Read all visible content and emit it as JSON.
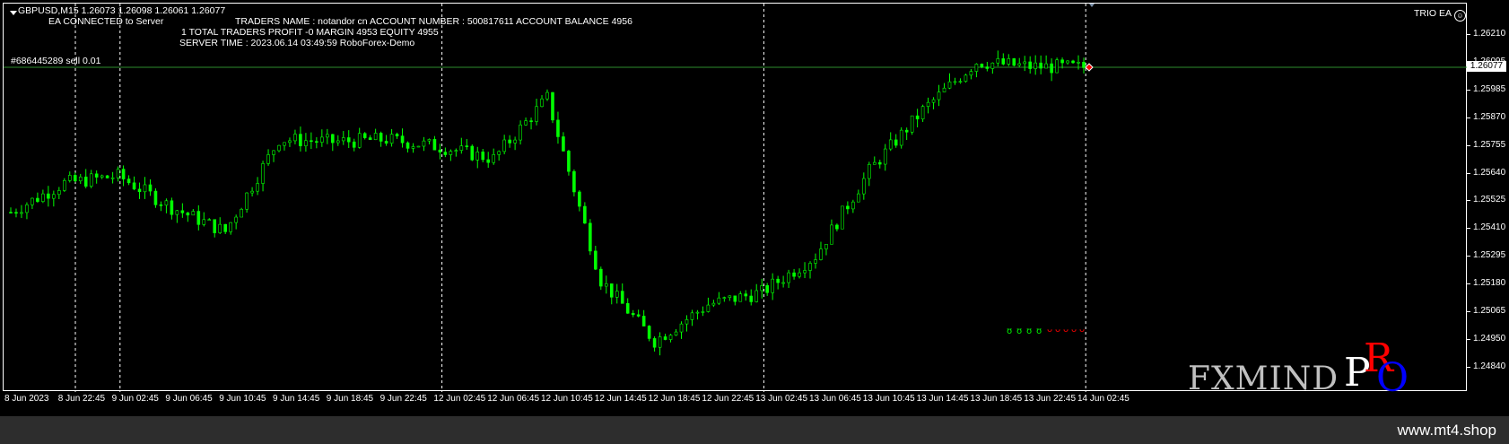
{
  "header": {
    "symbol_line": "GBPUSD,M15  1.26073 1.26098 1.26061 1.26077",
    "ea_status": "EA CONNECTED to Server",
    "traders_line": "TRADERS NAME : notandor cn  ACCOUNT NUMBER : 500817611 ACCOUNT BALANCE 4956",
    "totals_line": "1 TOTAL TRADERS  PROFIT -0 MARGIN 4953 EQUITY 4955",
    "server_line": "SERVER TIME : 2023.06.14 03:49:59  RoboForex-Demo",
    "expert_name": "TRIO EA",
    "expert_icon": "smiley-icon"
  },
  "order": {
    "label": "#686445289 sell 0.01"
  },
  "price_axis": {
    "ticks": [
      "1.26210",
      "1.26095",
      "1.25985",
      "1.25870",
      "1.25755",
      "1.25640",
      "1.25525",
      "1.25410",
      "1.25295",
      "1.25180",
      "1.25065",
      "1.24950",
      "1.24840"
    ],
    "current_price": "1.26077"
  },
  "time_axis": {
    "ticks": [
      "8 Jun 2023",
      "8 Jun 22:45",
      "9 Jun 02:45",
      "9 Jun 06:45",
      "9 Jun 10:45",
      "9 Jun 14:45",
      "9 Jun 18:45",
      "9 Jun 22:45",
      "12 Jun 02:45",
      "12 Jun 06:45",
      "12 Jun 10:45",
      "12 Jun 14:45",
      "12 Jun 18:45",
      "12 Jun 22:45",
      "13 Jun 02:45",
      "13 Jun 06:45",
      "13 Jun 10:45",
      "13 Jun 14:45",
      "13 Jun 18:45",
      "13 Jun 22:45",
      "14 Jun 02:45"
    ]
  },
  "chart_data": {
    "type": "candlestick",
    "symbol": "GBPUSD",
    "timeframe": "M15",
    "ylim": [
      1.2484,
      1.2625
    ],
    "last": 1.26077,
    "candle_color": "#00ff00",
    "path_key_points": [
      {
        "x": "8 Jun 2023",
        "y": 1.2548
      },
      {
        "x": "8 Jun 22:45",
        "y": 1.256
      },
      {
        "x": "9 Jun 02:45",
        "y": 1.2563
      },
      {
        "x": "9 Jun 06:45",
        "y": 1.255
      },
      {
        "x": "9 Jun 10:45",
        "y": 1.254
      },
      {
        "x": "9 Jun 14:45",
        "y": 1.2578
      },
      {
        "x": "9 Jun 18:45",
        "y": 1.2577
      },
      {
        "x": "9 Jun 22:45",
        "y": 1.2578
      },
      {
        "x": "12 Jun 02:45",
        "y": 1.2575
      },
      {
        "x": "12 Jun 06:45",
        "y": 1.257
      },
      {
        "x": "12 Jun 10:45",
        "y": 1.2595
      },
      {
        "x": "12 Jun 14:45",
        "y": 1.252
      },
      {
        "x": "12 Jun 18:45",
        "y": 1.2495
      },
      {
        "x": "12 Jun 22:45",
        "y": 1.251
      },
      {
        "x": "13 Jun 02:45",
        "y": 1.2515
      },
      {
        "x": "13 Jun 06:45",
        "y": 1.253
      },
      {
        "x": "13 Jun 10:45",
        "y": 1.2565
      },
      {
        "x": "13 Jun 14:45",
        "y": 1.259
      },
      {
        "x": "13 Jun 18:45",
        "y": 1.261
      },
      {
        "x": "13 Jun 22:45",
        "y": 1.2608
      },
      {
        "x": "14 Jun 02:45",
        "y": 1.26077
      }
    ]
  },
  "watermark": {
    "brand": "FXMIND",
    "pro_letters": [
      "P",
      "R",
      "O"
    ],
    "pro_colors": [
      "#ffffff",
      "#ff0000",
      "#0000ff"
    ]
  },
  "footer": {
    "url": "www.mt4.shop"
  },
  "colors": {
    "background": "#000000",
    "candles": "#00ff00",
    "order_line": "#2e8b2e",
    "grid_separator": "#ffffff",
    "indicator_red": "#ff0000"
  }
}
